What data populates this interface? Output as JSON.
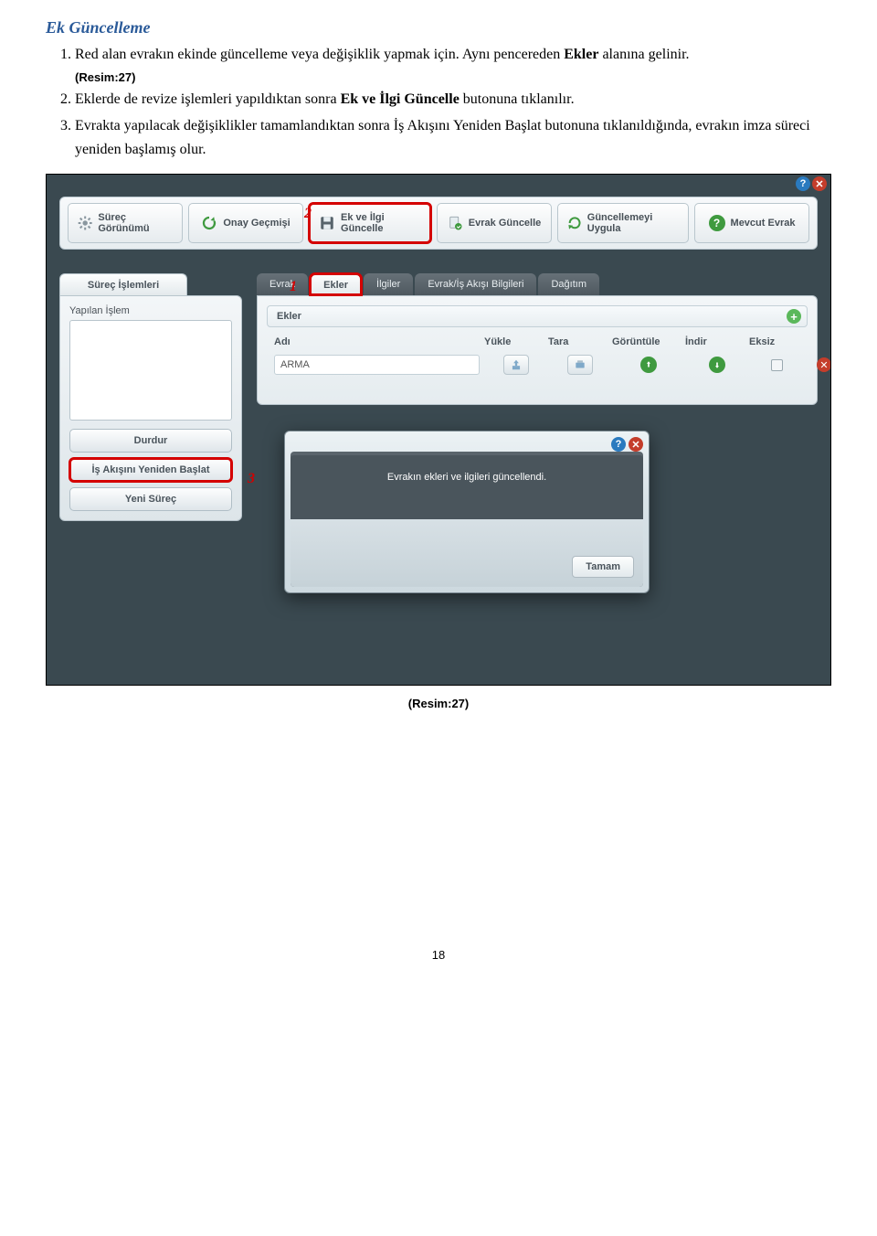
{
  "doc": {
    "section_title": "Ek Güncelleme",
    "item1_pre": "Red alan evrakın ekinde güncelleme veya değişiklik yapmak için. Aynı pencereden ",
    "item1_bold": "Ekler",
    "item1_post": " alanına gelinir.",
    "resim_ref": "(Resim:27)",
    "item2_pre": "Eklerde de revize işlemleri yapıldıktan sonra ",
    "item2_bold": "Ek ve İlgi Güncelle",
    "item2_post": " butonuna tıklanılır.",
    "item3": "Evrakta yapılacak değişiklikler tamamlandıktan sonra İş Akışını Yeniden Başlat butonuna tıklanıldığında, evrakın imza süreci yeniden başlamış olur.",
    "caption": "(Resim:27)",
    "page": "18"
  },
  "toolbar": {
    "b1": "Süreç Görünümü",
    "b2": "Onay Geçmişi",
    "b3": "Ek ve İlgi Güncelle",
    "b4": "Evrak Güncelle",
    "b5": "Güncellemeyi Uygula",
    "b6": "Mevcut Evrak"
  },
  "callouts": {
    "c1": "1",
    "c2": "2",
    "c3": "3"
  },
  "side": {
    "tab": "Süreç İşlemleri",
    "field": "Yapılan İşlem",
    "btn1": "Durdur",
    "btn2": "İş Akışını Yeniden Başlat",
    "btn3": "Yeni Süreç"
  },
  "tabs": {
    "t1": "Evrak",
    "t2": "Ekler",
    "t3": "İlgiler",
    "t4": "Evrak/İş Akışı Bilgileri",
    "t5": "Dağıtım"
  },
  "ekler": {
    "header": "Ekler",
    "cols": {
      "adi": "Adı",
      "yukle": "Yükle",
      "tara": "Tara",
      "goruntule": "Görüntüle",
      "indir": "İndir",
      "eksiz": "Eksiz"
    },
    "row1": {
      "adi": "ARMA"
    }
  },
  "modal": {
    "msg": "Evrakın ekleri ve ilgileri güncellendi.",
    "ok": "Tamam"
  }
}
